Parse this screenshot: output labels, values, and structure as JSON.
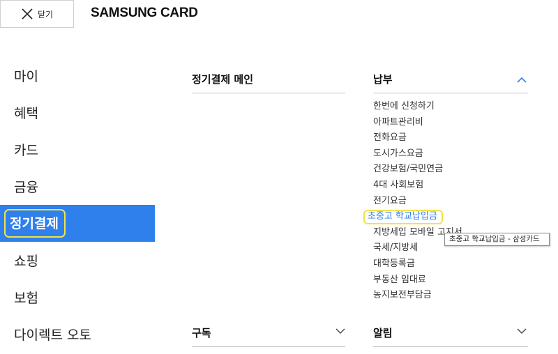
{
  "header": {
    "close_label": "닫기",
    "brand": "SAMSUNG CARD"
  },
  "sidebar": {
    "items": [
      {
        "label": "마이"
      },
      {
        "label": "혜택"
      },
      {
        "label": "카드"
      },
      {
        "label": "금융"
      },
      {
        "label": "정기결제",
        "active": true
      },
      {
        "label": "쇼핑"
      },
      {
        "label": "보험"
      },
      {
        "label": "다이렉트 오토"
      }
    ]
  },
  "main": {
    "section_main": "정기결제 메인",
    "section_payment": "납부",
    "payment_items": [
      "한번에 신청하기",
      "아파트관리비",
      "전화요금",
      "도시가스요금",
      "건강보험/국민연금",
      "4대 사회보험",
      "전기요금",
      "초중고 학교납입금",
      "지방세입 모바일 고지서",
      "국세/지방세",
      "대학등록금",
      "부동산 임대료",
      "농지보전부담금"
    ],
    "section_subscription": "구독",
    "section_alert": "알림"
  },
  "tooltip": "초중고 학교납입금 - 삼성카드",
  "colors": {
    "accent": "#2f80ed",
    "highlight": "#f1e34a"
  },
  "icons": {
    "close": "close-icon",
    "chevron_up": "chevron-up-icon",
    "chevron_down": "chevron-down-icon"
  }
}
